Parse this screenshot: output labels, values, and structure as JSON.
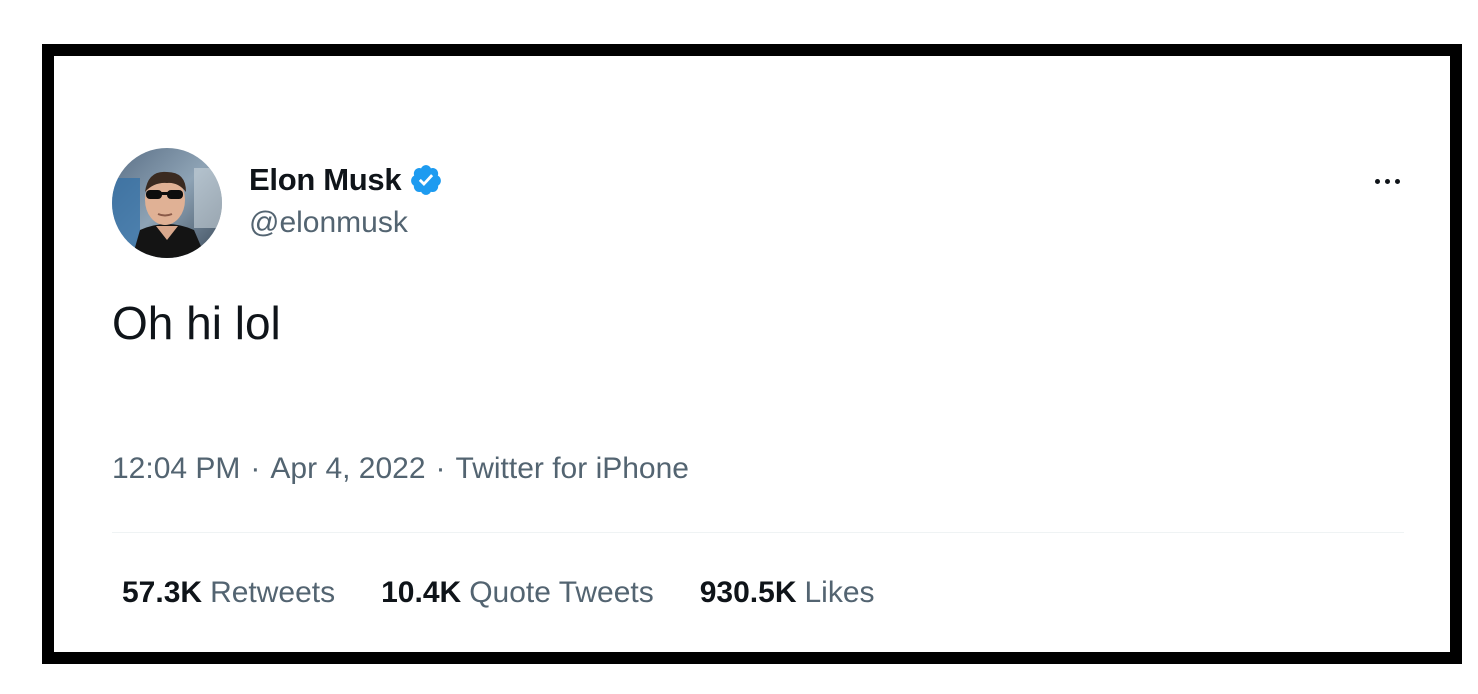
{
  "tweet": {
    "author": {
      "display_name": "Elon Musk",
      "handle": "@elonmusk",
      "verified": true,
      "avatar_icon": "profile-photo-avatar"
    },
    "text": "Oh hi lol",
    "meta": {
      "time": "12:04 PM",
      "date": "Apr 4, 2022",
      "source": "Twitter for iPhone",
      "separator": "·"
    },
    "stats": [
      {
        "count": "57.3K",
        "label": "Retweets"
      },
      {
        "count": "10.4K",
        "label": "Quote Tweets"
      },
      {
        "count": "930.5K",
        "label": "Likes"
      }
    ],
    "more_icon": "more-horizontal-icon"
  },
  "colors": {
    "text_primary": "#0f1419",
    "text_secondary": "#536471",
    "verified_blue": "#1d9bf0",
    "divider": "#eff3f4",
    "frame_border": "#000000"
  }
}
